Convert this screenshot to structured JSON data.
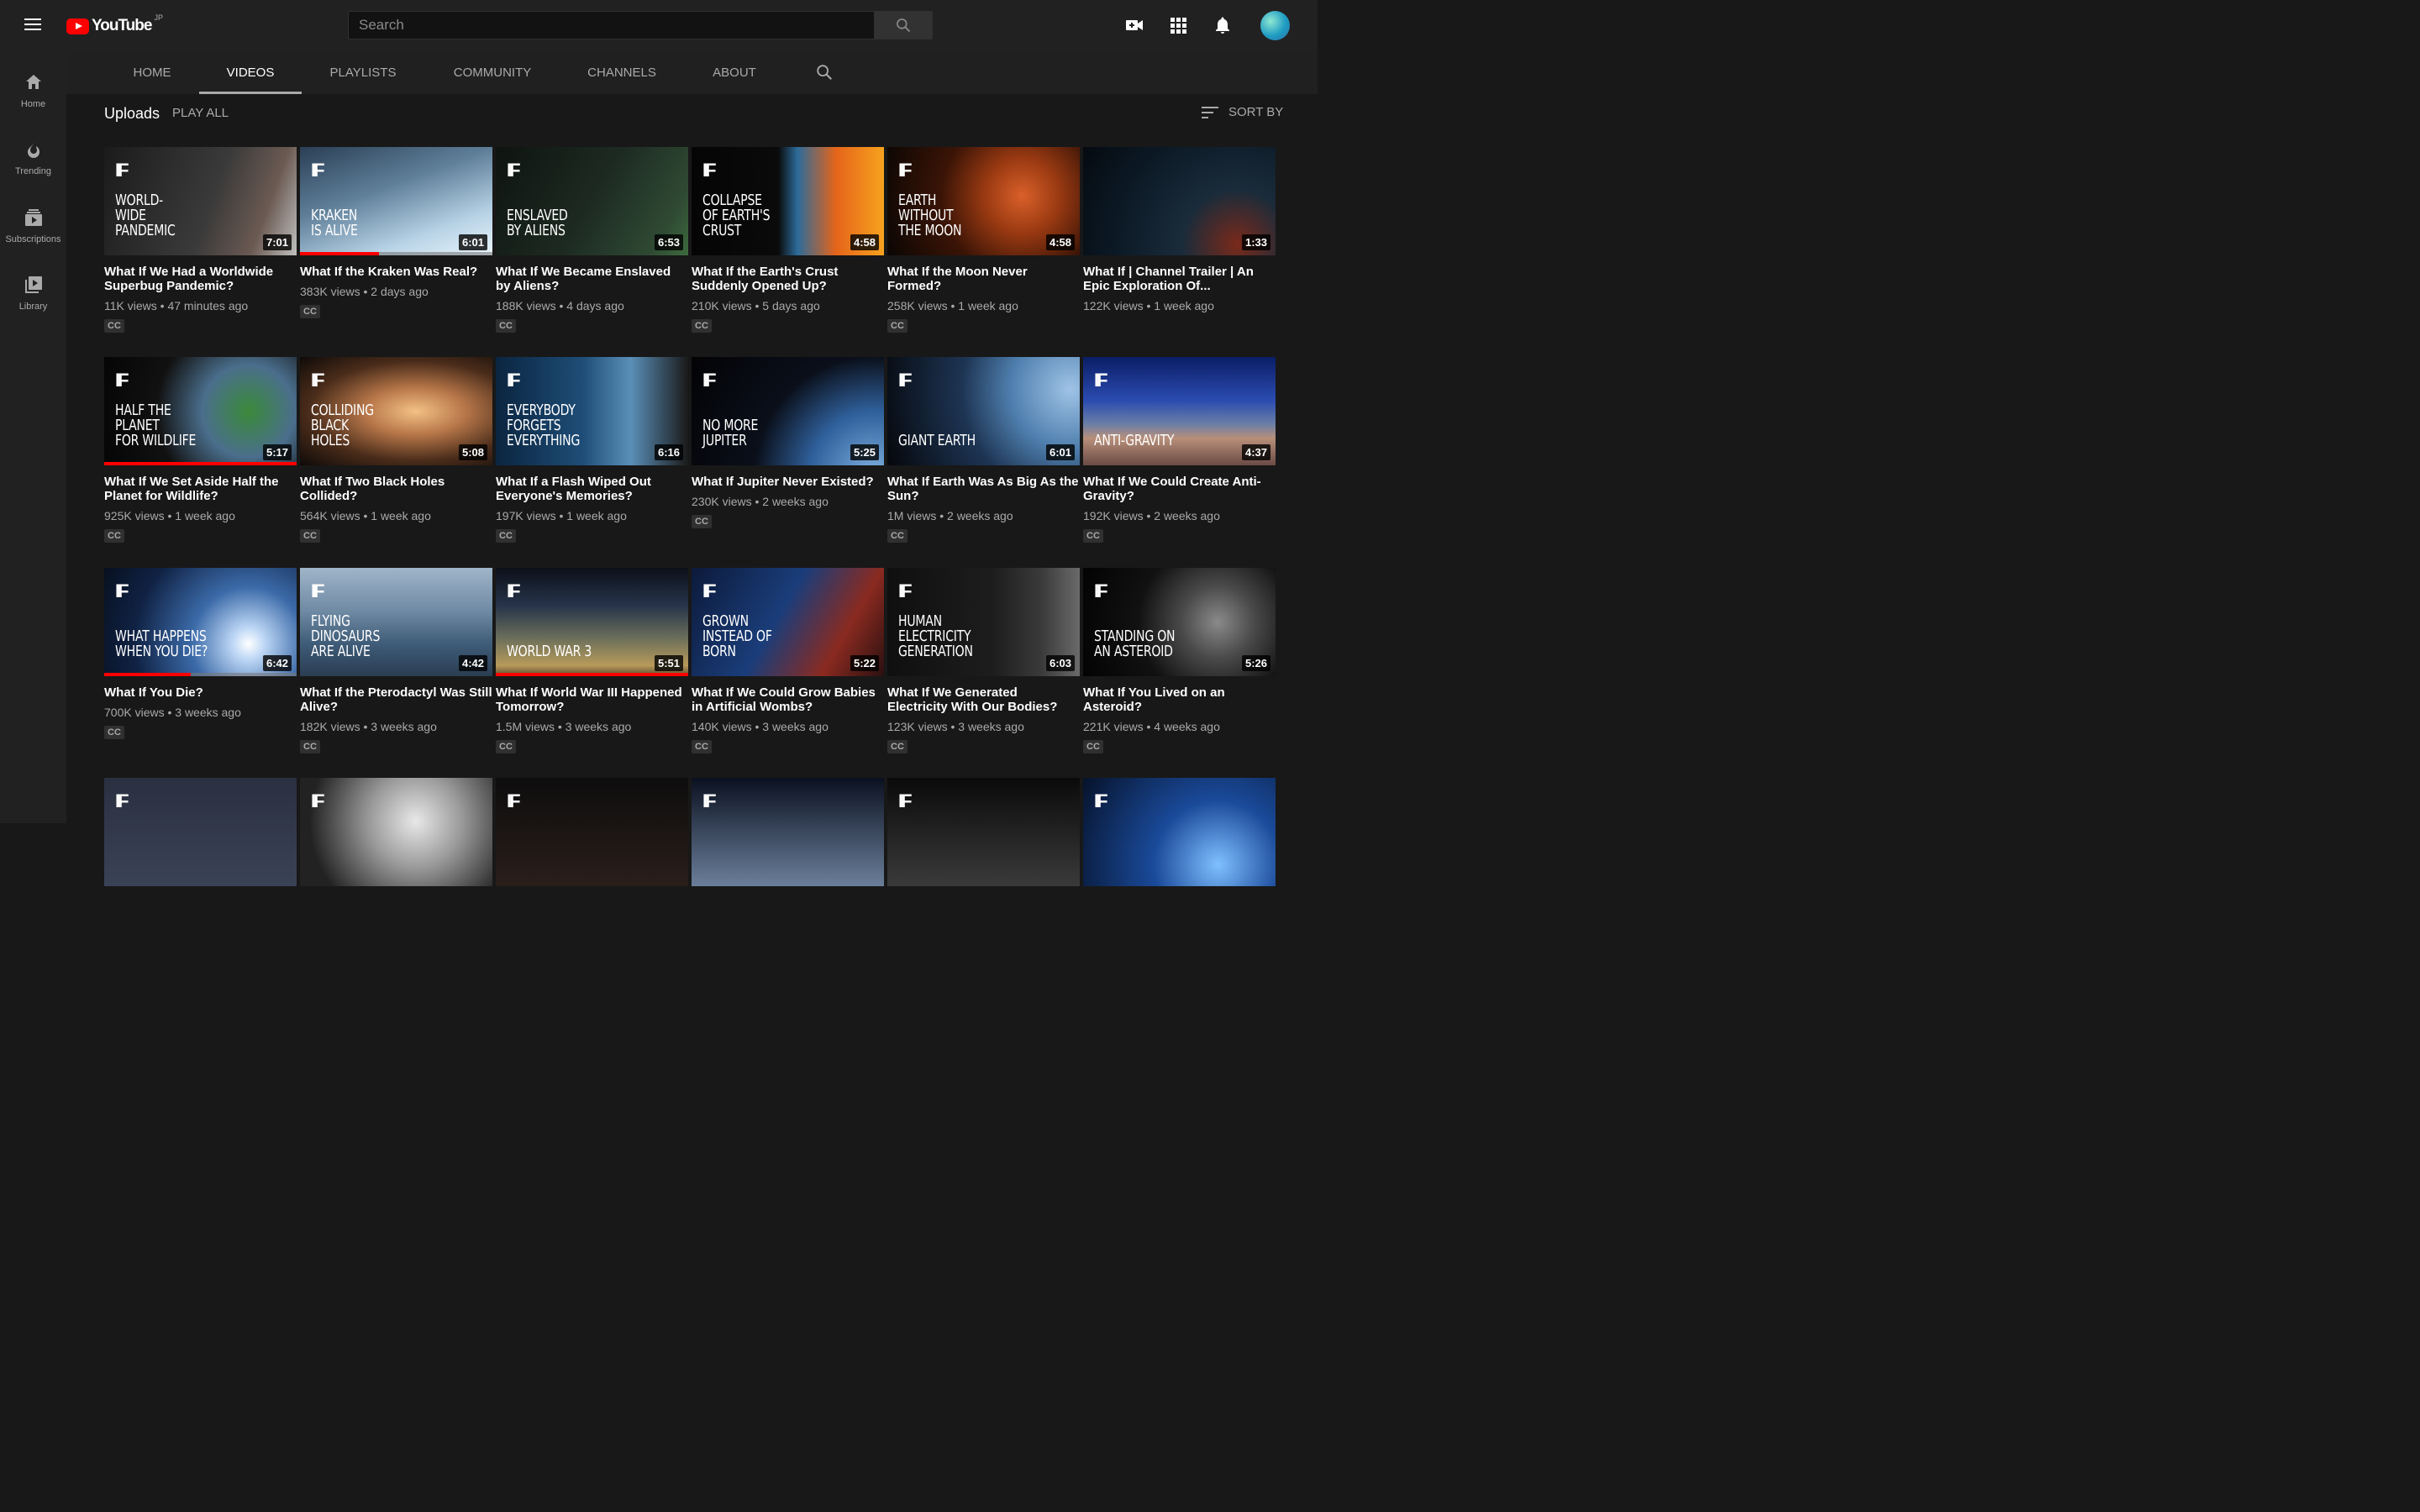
{
  "header": {
    "logo_text": "YouTube",
    "logo_region": "JP",
    "search_placeholder": "Search",
    "icons": [
      "menu-icon",
      "search-icon",
      "create-video-icon",
      "apps-icon",
      "notifications-icon",
      "avatar"
    ]
  },
  "sidebar": {
    "items": [
      {
        "label": "Home",
        "icon": "home-icon"
      },
      {
        "label": "Trending",
        "icon": "trending-icon"
      },
      {
        "label": "Subscriptions",
        "icon": "subscriptions-icon"
      },
      {
        "label": "Library",
        "icon": "library-icon"
      }
    ]
  },
  "tabs": [
    {
      "label": "HOME"
    },
    {
      "label": "VIDEOS",
      "active": true
    },
    {
      "label": "PLAYLISTS"
    },
    {
      "label": "COMMUNITY"
    },
    {
      "label": "CHANNELS"
    },
    {
      "label": "ABOUT"
    }
  ],
  "section": {
    "title": "Uploads",
    "play_all": "PLAY ALL",
    "sort_by": "SORT BY"
  },
  "colors": {
    "background": "#181818",
    "header": "#212121",
    "accent": "#ff0000",
    "secondary_text": "#aaaaaa"
  },
  "videos": [
    {
      "thumb_logo": "IF",
      "thumb_text": "WORLD-\nWIDE\nPANDEMIC",
      "duration": "7:01",
      "title": "What If We Had a Worldwide Superbug Pandemic?",
      "meta": "11K views • 47 minutes ago",
      "cc": "CC",
      "bg": "linear-gradient(110deg,#1b1b1b 0%,#3a3a3a 55%,#6b5a52 80%,#c0c0c0 100%)",
      "progress": 0
    },
    {
      "thumb_logo": "IF",
      "thumb_text": "KRAKEN\nIS ALIVE",
      "duration": "6:01",
      "title": "What If the Kraken Was Real?",
      "meta": "383K views • 2 days ago",
      "cc": "CC",
      "bg": "linear-gradient(160deg,#2a3f55 0%,#5f7f99 40%,#b8d3e6 75%,#e9f4fb 100%)",
      "progress": 0.41
    },
    {
      "thumb_logo": "IF",
      "thumb_text": "ENSLAVED\nBY ALIENS",
      "duration": "6:53",
      "title": "What If We Became Enslaved by Aliens?",
      "meta": "188K views • 4 days ago",
      "cc": "CC",
      "bg": "linear-gradient(120deg,#0e1410 0%,#1d2a22 50%,#2f4a33 85%,#3d6b3e 100%)",
      "progress": 0
    },
    {
      "thumb_logo": "IF",
      "thumb_text": "COLLAPSE\nOF EARTH'S\nCRUST",
      "duration": "4:58",
      "title": "What If the Earth's Crust Suddenly Opened Up?",
      "meta": "210K views • 5 days ago",
      "cc": "CC",
      "bg": "linear-gradient(90deg,#050505 0%,#0a0a0a 45%,#2c6b9a 55%,#e5641a 75%,#f7a21e 100%)",
      "progress": 0
    },
    {
      "thumb_logo": "IF",
      "thumb_text": "EARTH\nWITHOUT\nTHE MOON",
      "duration": "4:58",
      "title": "What If the Moon Never Formed?",
      "meta": "258K views • 1 week ago",
      "cc": "CC",
      "bg": "radial-gradient(circle at 70% 45%,#d9602a 0%,#9b3a12 25%,#3a1406 55%,#0b0604 100%)",
      "progress": 0
    },
    {
      "thumb_logo": "",
      "thumb_text": "",
      "duration": "1:33",
      "title": "What If | Channel Trailer | An Epic Exploration Of...",
      "meta": "122K views • 1 week ago",
      "cc": "",
      "bg": "radial-gradient(circle at 80% 90%,#7a2a1a 0%,#1a2b3a 30%,#0c1a26 65%,#050a10 100%)",
      "progress": 0
    },
    {
      "thumb_logo": "IF",
      "thumb_text": "HALF THE\nPLANET\nFOR WILDLIFE",
      "duration": "5:17",
      "title": "What If We Set Aside Half the Planet for Wildlife?",
      "meta": "925K views • 1 week ago",
      "cc": "CC",
      "bg": "radial-gradient(circle at 75% 50%,#3b8a3a 0%,#4a6e8c 30%,#111 60%,#050505 100%)",
      "progress": 1
    },
    {
      "thumb_logo": "IF",
      "thumb_text": "COLLIDING\nBLACK\nHOLES",
      "duration": "5:08",
      "title": "What If Two Black Holes Collided?",
      "meta": "564K views • 1 week ago",
      "cc": "CC",
      "bg": "radial-gradient(ellipse at 60% 50%,#f3c186 0%,#b9784a 30%,#4a2c1a 65%,#0e0a08 100%)",
      "progress": 0
    },
    {
      "thumb_logo": "IF",
      "thumb_text": "EVERYBODY\nFORGETS\nEVERYTHING",
      "duration": "6:16",
      "title": "What If a Flash Wiped Out Everyone's Memories?",
      "meta": "197K views • 1 week ago",
      "cc": "CC",
      "bg": "linear-gradient(90deg,#0b2540 0%,#1e4d77 45%,#5a8fb8 70%,#1a1a1a 100%)",
      "progress": 0
    },
    {
      "thumb_logo": "IF",
      "thumb_text": "NO MORE\nJUPITER",
      "duration": "5:25",
      "title": "What If Jupiter Never Existed?",
      "meta": "230K views • 2 weeks ago",
      "cc": "CC",
      "bg": "radial-gradient(circle at 95% 110%,#7fb1e0 0%,#2f5f9a 30%,#0a0f1a 55%,#030305 100%)",
      "progress": 0
    },
    {
      "thumb_logo": "IF",
      "thumb_text": "GIANT EARTH",
      "duration": "6:01",
      "title": "What If Earth Was As Big As the Sun?",
      "meta": "1M views • 2 weeks ago",
      "cc": "CC",
      "bg": "radial-gradient(circle at 95% 30%,#9fc3e6 0%,#4f7fae 30%,#1d3453 55%,#05070b 100%)",
      "progress": 0
    },
    {
      "thumb_logo": "IF",
      "thumb_text": "ANTI-GRAVITY",
      "duration": "4:37",
      "title": "What If We Could Create Anti-Gravity?",
      "meta": "192K views • 2 weeks ago",
      "cc": "CC",
      "bg": "linear-gradient(180deg,#0b1e66 0%,#2a4bb0 40%,#6b7fa6 62%,#b78f7a 75%,#6b4b45 100%)",
      "progress": 0
    },
    {
      "thumb_logo": "IF",
      "thumb_text": "WHAT HAPPENS\nWHEN YOU DIE?",
      "duration": "6:42",
      "title": "What If You Die?",
      "meta": "700K views • 3 weeks ago",
      "cc": "CC",
      "bg": "radial-gradient(circle at 75% 70%,#ffffff 0%,#bcd6f5 10%,#3b6aa8 35%,#102244 70%,#07101f 100%)",
      "progress": 0.45
    },
    {
      "thumb_logo": "IF",
      "thumb_text": "FLYING\nDINOSAURS\nARE ALIVE",
      "duration": "4:42",
      "title": "What If the Pterodactyl Was Still Alive?",
      "meta": "182K views • 3 weeks ago",
      "cc": "CC",
      "bg": "linear-gradient(180deg,#9fb5c9 0%,#6f8aa3 40%,#3f5c78 70%,#2a3d52 100%)",
      "progress": 0
    },
    {
      "thumb_logo": "IF",
      "thumb_text": "WORLD WAR 3",
      "duration": "5:51",
      "title": "What If World War III Happened Tomorrow?",
      "meta": "1.5M views • 3 weeks ago",
      "cc": "CC",
      "bg": "linear-gradient(180deg,#0b1018 0%,#27344a 35%,#6b6f5a 65%,#b89a5a 90%,#5a4a30 100%)",
      "progress": 1
    },
    {
      "thumb_logo": "IF",
      "thumb_text": "GROWN\nINSTEAD OF\nBORN",
      "duration": "5:22",
      "title": "What If We Could Grow Babies in Artificial Wombs?",
      "meta": "140K views • 3 weeks ago",
      "cc": "CC",
      "bg": "linear-gradient(120deg,#0c1a3a 0%,#1a3d7a 45%,#8a2a20 75%,#2a1010 100%)",
      "progress": 0
    },
    {
      "thumb_logo": "IF",
      "thumb_text": "HUMAN\nELECTRICITY\nGENERATION",
      "duration": "6:03",
      "title": "What If We Generated Electricity With Our Bodies?",
      "meta": "123K views • 3 weeks ago",
      "cc": "CC",
      "bg": "linear-gradient(90deg,#0f0f0f 0%,#1d1d1d 55%,#3a3a3a 80%,#6a6a6a 100%)",
      "progress": 0
    },
    {
      "thumb_logo": "IF",
      "thumb_text": "STANDING ON\nAN ASTEROID",
      "duration": "5:26",
      "title": "What If You Lived on an Asteroid?",
      "meta": "221K views • 4 weeks ago",
      "cc": "CC",
      "bg": "radial-gradient(circle at 70% 50%,#8a8a8a 0%,#4a4a4a 25%,#111 55%,#030303 100%)",
      "progress": 0
    },
    {
      "thumb_logo": "IF",
      "thumb_text": "",
      "duration": "",
      "title": "",
      "meta": "",
      "cc": "",
      "bg": "linear-gradient(180deg,#2a3040 0%,#3a4256 100%)",
      "progress": 0
    },
    {
      "thumb_logo": "IF",
      "thumb_text": "",
      "duration": "",
      "title": "",
      "meta": "",
      "cc": "",
      "bg": "radial-gradient(circle at 60% 40%,#e8e8e8 0%,#9a9a9a 35%,#222 80%)",
      "progress": 0
    },
    {
      "thumb_logo": "IF",
      "thumb_text": "",
      "duration": "",
      "title": "",
      "meta": "",
      "cc": "",
      "bg": "linear-gradient(180deg,#0d0d0d 0%,#2a1e1a 100%)",
      "progress": 0
    },
    {
      "thumb_logo": "IF",
      "thumb_text": "",
      "duration": "",
      "title": "",
      "meta": "",
      "cc": "",
      "bg": "linear-gradient(180deg,#0a1020 0%,#6b7f9a 100%)",
      "progress": 0
    },
    {
      "thumb_logo": "IF",
      "thumb_text": "",
      "duration": "",
      "title": "",
      "meta": "",
      "cc": "",
      "bg": "linear-gradient(180deg,#0a0a0a 0%,#3a3a3a 100%)",
      "progress": 0
    },
    {
      "thumb_logo": "IF",
      "thumb_text": "",
      "duration": "",
      "title": "",
      "meta": "",
      "cc": "",
      "bg": "radial-gradient(circle at 70% 80%,#7fbfff 0%,#1a4a9a 40%,#06122a 100%)",
      "progress": 0
    }
  ]
}
